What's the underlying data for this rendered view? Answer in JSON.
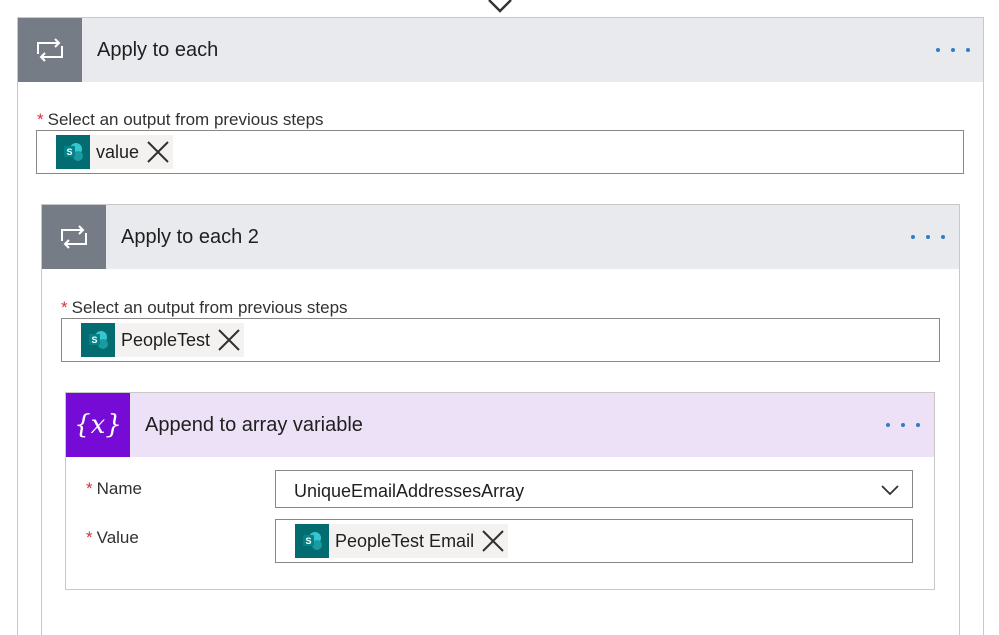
{
  "outer": {
    "title": "Apply to each",
    "field_label": "Select an output from previous steps",
    "token": {
      "text": "value",
      "icon": "sharepoint-icon"
    }
  },
  "inner": {
    "title": "Apply to each 2",
    "field_label": "Select an output from previous steps",
    "token": {
      "text": "PeopleTest",
      "icon": "sharepoint-icon"
    }
  },
  "action": {
    "title": "Append to array variable",
    "icon_text": "{x}",
    "name_label": "Name",
    "name_value": "UniqueEmailAddressesArray",
    "value_label": "Value",
    "value_token": {
      "text": "PeopleTest Email",
      "icon": "sharepoint-icon"
    }
  },
  "required_marker": "*",
  "colors": {
    "loop_tile": "#767c85",
    "header_bg": "#e8eaed",
    "variable_tile": "#770bd6",
    "variable_header_bg": "#ece1f6",
    "sharepoint": "#036c70",
    "required": "#d13438",
    "more_dots": "#2f7cc7"
  }
}
